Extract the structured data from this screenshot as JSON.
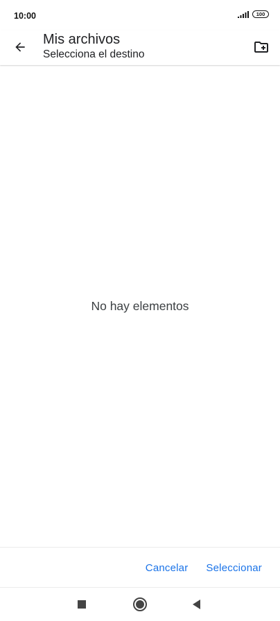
{
  "status_bar": {
    "time": "10:00",
    "battery_level": "100",
    "signal_icon": "signal-icon"
  },
  "app_bar": {
    "back_icon": "arrow-back-icon",
    "title": "Mis archivos",
    "subtitle": "Selecciona el destino",
    "new_folder_icon": "create-new-folder-icon"
  },
  "content": {
    "empty_message": "No hay elementos"
  },
  "actions": {
    "cancel_label": "Cancelar",
    "select_label": "Seleccionar"
  },
  "nav_bar": {
    "recents_icon": "square-icon",
    "home_icon": "circle-icon",
    "back_icon": "triangle-back-icon"
  },
  "colors": {
    "accent": "#1a73e8",
    "text": "#202124",
    "background": "#ffffff"
  }
}
